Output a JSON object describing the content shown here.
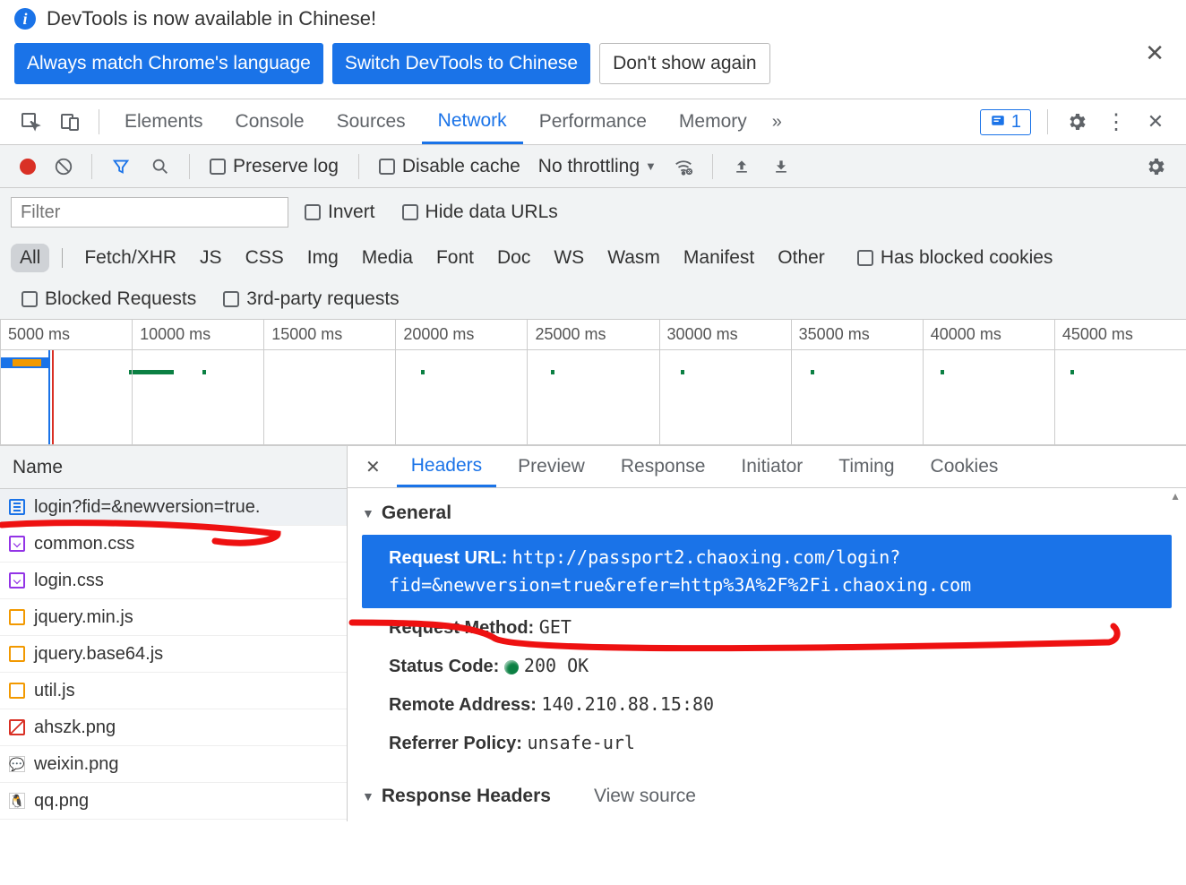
{
  "infobar": {
    "text": "DevTools is now available in Chinese!",
    "btn_match": "Always match Chrome's language",
    "btn_switch": "Switch DevTools to Chinese",
    "btn_dont": "Don't show again"
  },
  "tabs": {
    "elements": "Elements",
    "console": "Console",
    "sources": "Sources",
    "network": "Network",
    "performance": "Performance",
    "memory": "Memory",
    "issues_count": "1"
  },
  "nettb": {
    "preserve": "Preserve log",
    "disable_cache": "Disable cache",
    "throttling": "No throttling"
  },
  "filters": {
    "placeholder": "Filter",
    "invert": "Invert",
    "hide_data": "Hide data URLs",
    "all": "All",
    "fetch": "Fetch/XHR",
    "js": "JS",
    "css": "CSS",
    "img": "Img",
    "media": "Media",
    "font": "Font",
    "doc": "Doc",
    "ws": "WS",
    "wasm": "Wasm",
    "manifest": "Manifest",
    "other": "Other",
    "blocked_cookies": "Has blocked cookies",
    "blocked_req": "Blocked Requests",
    "third_party": "3rd-party requests"
  },
  "timeline": {
    "ticks": [
      "5000 ms",
      "10000 ms",
      "15000 ms",
      "20000 ms",
      "25000 ms",
      "30000 ms",
      "35000 ms",
      "40000 ms",
      "45000 ms"
    ]
  },
  "requests": {
    "header": "Name",
    "items": [
      {
        "name": "login?fid=&newversion=true.",
        "type": "doc",
        "selected": true
      },
      {
        "name": "common.css",
        "type": "css"
      },
      {
        "name": "login.css",
        "type": "css"
      },
      {
        "name": "jquery.min.js",
        "type": "js"
      },
      {
        "name": "jquery.base64.js",
        "type": "js"
      },
      {
        "name": "util.js",
        "type": "js"
      },
      {
        "name": "ahszk.png",
        "type": "img"
      },
      {
        "name": "weixin.png",
        "type": "png"
      },
      {
        "name": "qq.png",
        "type": "png"
      }
    ]
  },
  "details": {
    "tabs": {
      "headers": "Headers",
      "preview": "Preview",
      "response": "Response",
      "initiator": "Initiator",
      "timing": "Timing",
      "cookies": "Cookies"
    },
    "general": "General",
    "request_url_label": "Request URL:",
    "request_url_value": "http://passport2.chaoxing.com/login?fid=&newversion=true&refer=http%3A%2F%2Fi.chaoxing.com",
    "method_label": "Request Method:",
    "method_value": "GET",
    "status_label": "Status Code:",
    "status_value": "200 OK",
    "remote_label": "Remote Address:",
    "remote_value": "140.210.88.15:80",
    "referrer_label": "Referrer Policy:",
    "referrer_value": "unsafe-url",
    "response_headers": "Response Headers",
    "view_source": "View source"
  }
}
